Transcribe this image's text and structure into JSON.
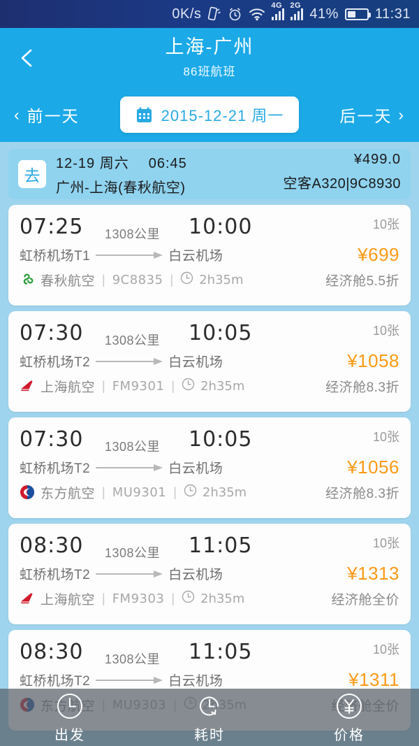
{
  "status_bar": {
    "net_speed": "0K/s",
    "battery_percent": "41%",
    "clock": "11:31",
    "signal_4g": "4G",
    "signal_2g": "2G",
    "icons": [
      "vibrate-icon",
      "alarm-icon",
      "wifi-icon",
      "signal-4g-icon",
      "signal-2g-icon",
      "battery-icon"
    ]
  },
  "header": {
    "back_icon": "chevron-left-icon",
    "title": "上海-广州",
    "subtitle": "86班航班",
    "bg_color": "#1ba9e8"
  },
  "date_nav": {
    "prev_label": "前一天",
    "prev_chevron": "‹",
    "next_label": "后一天",
    "next_chevron": "›",
    "calendar_icon": "calendar-icon",
    "current_date": "2015-12-21 周一",
    "date_color": "#2aaae2"
  },
  "outbound": {
    "badge": "去",
    "date": "12-19 周六",
    "time": "06:45",
    "route": "广州-上海(春秋航空)",
    "price": "¥499.0",
    "aircraft": "空客A320|9C8930"
  },
  "flights": [
    {
      "depart_time": "07:25",
      "arrive_time": "10:00",
      "distance": "1308公里",
      "depart_airport": "虹桥机场T1",
      "arrive_airport": "白云机场",
      "airline": "春秋航空",
      "airline_logo": "spring-airlines-logo",
      "flight_no": "9C8835",
      "duration": "2h35m",
      "seats": "10张",
      "price": "¥699",
      "cabin": "经济舱5.5折"
    },
    {
      "depart_time": "07:30",
      "arrive_time": "10:05",
      "distance": "1308公里",
      "depart_airport": "虹桥机场T2",
      "arrive_airport": "白云机场",
      "airline": "上海航空",
      "airline_logo": "shanghai-airlines-logo",
      "flight_no": "FM9301",
      "duration": "2h35m",
      "seats": "10张",
      "price": "¥1058",
      "cabin": "经济舱8.3折"
    },
    {
      "depart_time": "07:30",
      "arrive_time": "10:05",
      "distance": "1308公里",
      "depart_airport": "虹桥机场T2",
      "arrive_airport": "白云机场",
      "airline": "东方航空",
      "airline_logo": "china-eastern-logo",
      "flight_no": "MU9301",
      "duration": "2h35m",
      "seats": "10张",
      "price": "¥1056",
      "cabin": "经济舱8.3折"
    },
    {
      "depart_time": "08:30",
      "arrive_time": "11:05",
      "distance": "1308公里",
      "depart_airport": "虹桥机场T2",
      "arrive_airport": "白云机场",
      "airline": "上海航空",
      "airline_logo": "shanghai-airlines-logo",
      "flight_no": "FM9303",
      "duration": "2h35m",
      "seats": "10张",
      "price": "¥1313",
      "cabin": "经济舱全价"
    },
    {
      "depart_time": "08:30",
      "arrive_time": "11:05",
      "distance": "1308公里",
      "depart_airport": "虹桥机场T2",
      "arrive_airport": "白云机场",
      "airline": "东方航空",
      "airline_logo": "china-eastern-logo",
      "flight_no": "MU9303",
      "duration": "2h35m",
      "seats": "10张",
      "price": "¥1311",
      "cabin": "经济舱全价"
    }
  ],
  "sort_bar": [
    {
      "label": "出发",
      "icon": "clock-icon"
    },
    {
      "label": "耗时",
      "icon": "duration-refresh-icon"
    },
    {
      "label": "价格",
      "icon": "yuan-circle-icon"
    }
  ],
  "colors": {
    "accent": "#1ba9e8",
    "price": "#fa9a16",
    "page_bg": "#9ed4ed",
    "card_bg": "#fdfdfd"
  }
}
